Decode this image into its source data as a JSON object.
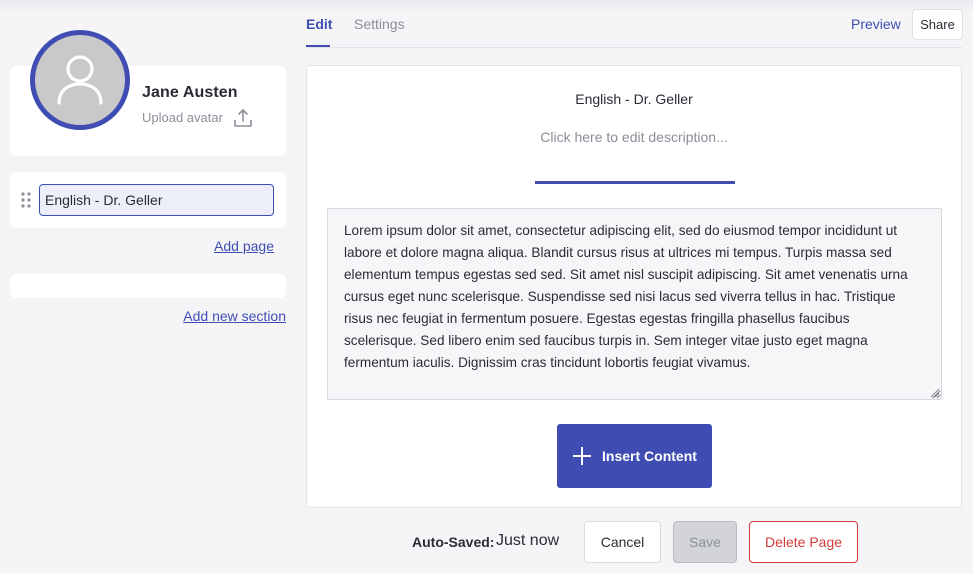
{
  "profile": {
    "name": "Jane Austen",
    "upload_avatar_label": "Upload avatar"
  },
  "sidebar": {
    "pages": [
      {
        "title": "English - Dr. Geller"
      }
    ],
    "add_page_label": "Add page",
    "add_section_label": "Add new section"
  },
  "header": {
    "tabs": [
      {
        "label": "Edit",
        "active": true
      },
      {
        "label": "Settings",
        "active": false
      }
    ],
    "preview_label": "Preview",
    "share_label": "Share"
  },
  "editor": {
    "page_title": "English - Dr. Geller",
    "description_placeholder": "Click here to edit description...",
    "content": "Lorem ipsum dolor sit amet, consectetur adipiscing elit, sed do eiusmod tempor incididunt ut labore et dolore magna aliqua. Blandit cursus risus at ultrices mi tempus. Turpis massa sed elementum tempus egestas sed sed. Sit amet nisl suscipit adipiscing. Sit amet venenatis urna cursus eget nunc scelerisque. Suspendisse sed nisi lacus sed viverra tellus in hac. Tristique risus nec feugiat in fermentum posuere. Egestas egestas fringilla phasellus faucibus scelerisque. Sed libero enim sed faucibus turpis in. Sem integer vitae justo eget magna fermentum iaculis. Dignissim cras tincidunt lobortis feugiat vivamus.",
    "insert_content_label": "Insert Content"
  },
  "footer": {
    "autosaved_label": "Auto-Saved:",
    "autosaved_value": "Just now",
    "cancel_label": "Cancel",
    "save_label": "Save",
    "delete_label": "Delete Page"
  },
  "colors": {
    "accent": "#3f4db3",
    "danger": "#d33a3a",
    "background": "#f5f5f8",
    "muted_text": "#8a8f99"
  },
  "icons": {
    "avatar": "user-silhouette-icon",
    "upload": "upload-icon",
    "drag": "drag-handle-icon",
    "insert": "plus-icon",
    "resize": "resize-grip-icon"
  }
}
